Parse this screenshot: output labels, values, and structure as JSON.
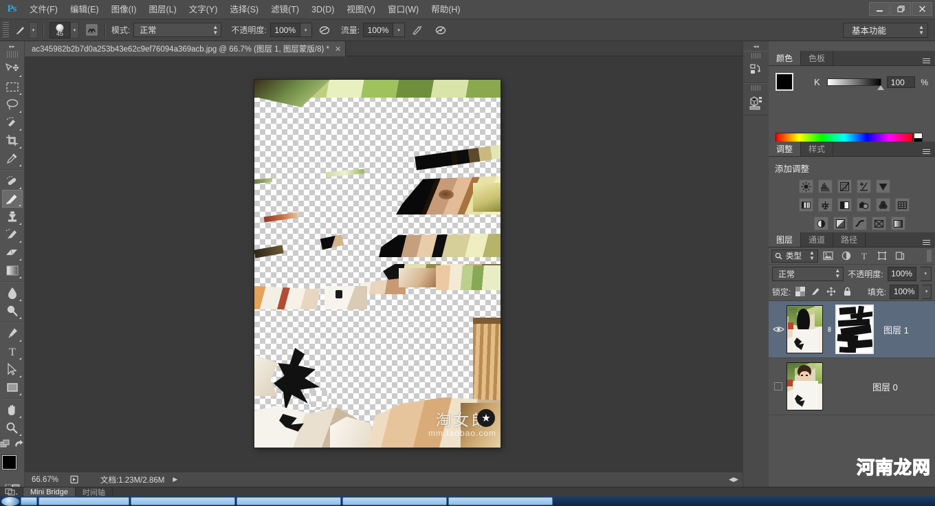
{
  "app": {
    "logo": "Ps",
    "window_controls": {
      "minimize": "—",
      "restore": "❐",
      "close": "✕"
    }
  },
  "menu": {
    "items": [
      {
        "label": "文件(F)"
      },
      {
        "label": "编辑(E)"
      },
      {
        "label": "图像(I)"
      },
      {
        "label": "图层(L)"
      },
      {
        "label": "文字(Y)"
      },
      {
        "label": "选择(S)"
      },
      {
        "label": "滤镜(T)"
      },
      {
        "label": "3D(D)"
      },
      {
        "label": "视图(V)"
      },
      {
        "label": "窗口(W)"
      },
      {
        "label": "帮助(H)"
      }
    ]
  },
  "options_bar": {
    "brush_size": "45",
    "mode_label": "模式:",
    "mode_value": "正常",
    "opacity_label": "不透明度:",
    "opacity_value": "100%",
    "flow_label": "流量:",
    "flow_value": "100%",
    "workspace": "基本功能"
  },
  "toolbar": {
    "tools": [
      {
        "name": "move-tool",
        "label": "移动工具",
        "active": false
      },
      {
        "name": "marquee-tool",
        "label": "矩形选框工具",
        "active": false
      },
      {
        "name": "lasso-tool",
        "label": "套索工具",
        "active": false
      },
      {
        "name": "quick-selection-tool",
        "label": "快速选择工具",
        "active": false
      },
      {
        "name": "crop-tool",
        "label": "裁剪工具",
        "active": false
      },
      {
        "name": "eyedropper-tool",
        "label": "吸管工具",
        "active": false
      },
      {
        "name": "healing-brush-tool",
        "label": "污点修复画笔工具",
        "active": false
      },
      {
        "name": "brush-tool",
        "label": "画笔工具",
        "active": true
      },
      {
        "name": "clone-stamp-tool",
        "label": "仿制图章工具",
        "active": false
      },
      {
        "name": "history-brush-tool",
        "label": "历史记录画笔工具",
        "active": false
      },
      {
        "name": "eraser-tool",
        "label": "橡皮擦工具",
        "active": false
      },
      {
        "name": "gradient-tool",
        "label": "渐变工具",
        "active": false
      },
      {
        "name": "blur-tool",
        "label": "模糊工具",
        "active": false
      },
      {
        "name": "dodge-tool",
        "label": "减淡工具",
        "active": false
      },
      {
        "name": "pen-tool",
        "label": "钢笔工具",
        "active": false
      },
      {
        "name": "type-tool",
        "label": "横排文字工具",
        "active": false
      },
      {
        "name": "path-selection-tool",
        "label": "路径选择工具",
        "active": false
      },
      {
        "name": "rectangle-tool",
        "label": "矩形工具",
        "active": false
      },
      {
        "name": "hand-tool",
        "label": "抓手工具",
        "active": false
      },
      {
        "name": "zoom-tool",
        "label": "缩放工具",
        "active": false
      }
    ],
    "foreground_color": "#000000",
    "background_color": "#ffffff"
  },
  "document": {
    "tab_title": "ac345982b2b7d0a253b43e62c9ef76094a369acb.jpg @ 66.7% (图层 1, 图层蒙版/8) *",
    "close": "✕"
  },
  "status_bar": {
    "zoom": "66.67%",
    "doc_info": "文档:1.23M/2.86M",
    "play_arrow": "▶"
  },
  "color_panel": {
    "tabs": [
      {
        "label": "颜色",
        "active": true
      },
      {
        "label": "色板",
        "active": false
      }
    ],
    "channel_label": "K",
    "value": "100",
    "unit": "%"
  },
  "adjustments_panel": {
    "tabs": [
      {
        "label": "调整",
        "active": true
      },
      {
        "label": "样式",
        "active": false
      }
    ],
    "title": "添加调整",
    "row1": [
      "brightness-contrast-icon",
      "levels-icon",
      "curves-icon",
      "exposure-icon",
      "vibrance-icon"
    ],
    "row2": [
      "hue-saturation-icon",
      "color-balance-icon",
      "black-white-icon",
      "photo-filter-icon",
      "channel-mixer-icon",
      "color-lookup-icon"
    ],
    "row3": [
      "invert-icon",
      "posterize-icon",
      "threshold-icon",
      "selective-color-icon",
      "gradient-map-icon"
    ]
  },
  "layers_panel": {
    "tabs": [
      {
        "label": "图层",
        "active": true
      },
      {
        "label": "通道",
        "active": false
      },
      {
        "label": "路径",
        "active": false
      }
    ],
    "filter_kind": "类型",
    "blend_mode": "正常",
    "opacity_label": "不透明度:",
    "opacity_value": "100%",
    "lock_label": "锁定:",
    "fill_label": "填充:",
    "fill_value": "100%",
    "layers": [
      {
        "name": "图层 1",
        "visible": true,
        "selected": true,
        "has_mask": true
      },
      {
        "name": "图层 0",
        "visible": false,
        "selected": false,
        "has_mask": false
      }
    ],
    "bottom_icons": [
      "link-icon",
      "fx-icon",
      "add-mask-icon",
      "new-adjustment-icon",
      "new-group-icon",
      "new-layer-icon",
      "delete-layer-icon"
    ]
  },
  "bottom_tabs": {
    "items": [
      {
        "label": "Mini Bridge",
        "active": true
      },
      {
        "label": "时间轴",
        "active": false
      }
    ]
  },
  "watermarks": {
    "canvas_main": "淘女郎",
    "canvas_sub": "mm.taobao.com",
    "corner": "河南龙网"
  }
}
